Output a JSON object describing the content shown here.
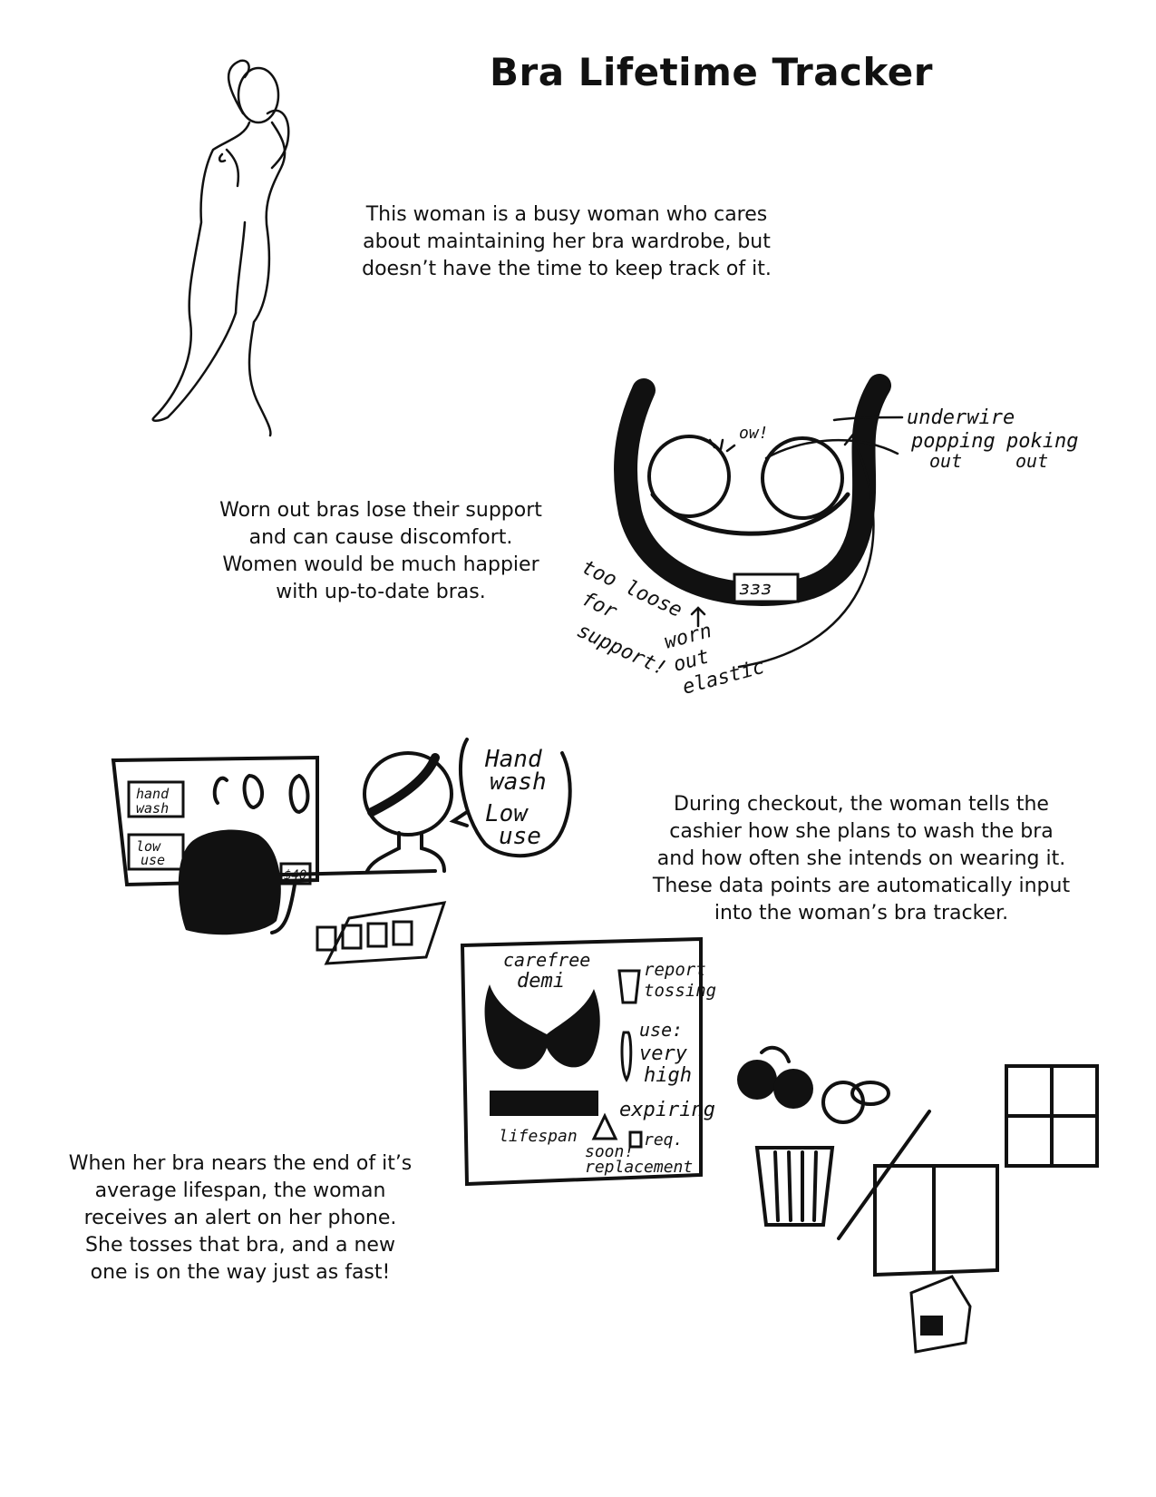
{
  "page": {
    "title": "Bra Lifetime Tracker",
    "paragraphs": [
      {
        "lines": [
          "This woman is a busy woman who cares",
          "about maintaining her bra wardrobe, but",
          "doesn’t have the time to keep track of it."
        ]
      },
      {
        "lines": [
          "Worn out bras lose their support",
          "and can cause discomfort.",
          "Women would be much happier",
          "with up-to-date bras."
        ]
      },
      {
        "lines": [
          "During checkout, the woman tells the",
          "cashier how she plans to wash the bra",
          "and how often she intends on wearing it.",
          "These data points are automatically input",
          "into the woman’s bra tracker."
        ]
      },
      {
        "lines": [
          "When her bra nears the end of it’s",
          "average lifespan, the woman",
          "receives an alert on her phone.",
          "She tosses that bra, and a new",
          "one is on the way just as fast!"
        ]
      }
    ]
  },
  "sketch_bra": {
    "ow": "ow!",
    "underwire_label": [
      "underwire",
      "popping",
      "out"
    ],
    "poking_label": [
      "poking",
      "out"
    ],
    "loose_label": [
      "too loose",
      "for",
      "support!"
    ],
    "elastic_label": [
      "worn",
      "out",
      "elastic"
    ]
  },
  "sketch_checkout": {
    "tag_hand_wash": [
      "hand",
      "wash"
    ],
    "tag_low_use": [
      "low",
      "use"
    ],
    "price": "$40",
    "speech": [
      "Hand",
      "wash",
      "Low",
      "use"
    ]
  },
  "sketch_app": {
    "product_name": [
      "carefree",
      "demi"
    ],
    "report": [
      "report",
      "tossing"
    ],
    "use_label": [
      "use:",
      "very",
      "high"
    ],
    "lifespan": "lifespan",
    "alert": [
      "expiring",
      "soon!",
      "req.",
      "replacement"
    ]
  }
}
